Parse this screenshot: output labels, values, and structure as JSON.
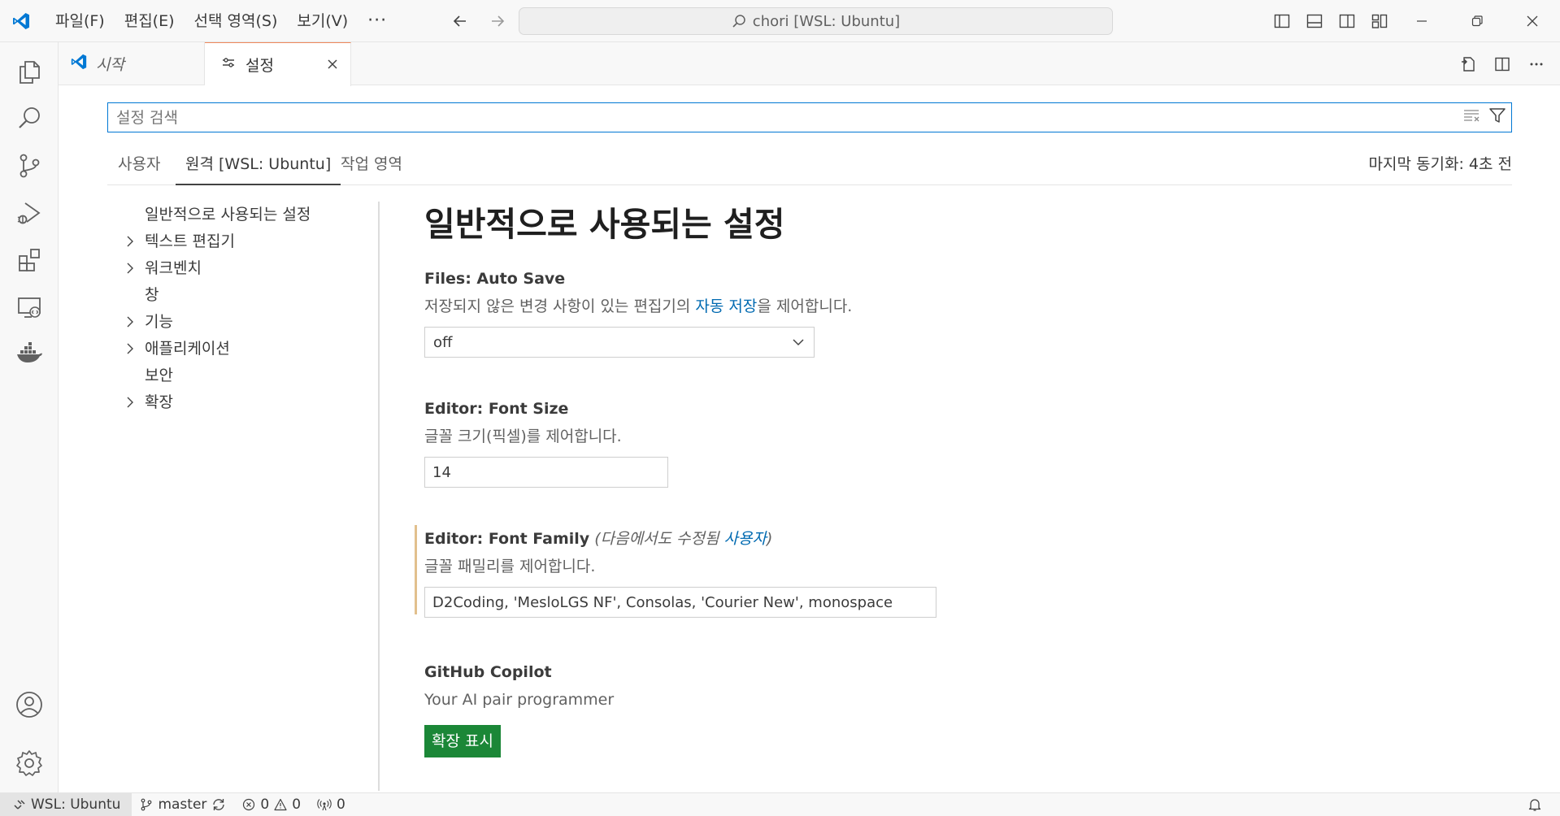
{
  "titlebar": {
    "menu": [
      "파일(F)",
      "편집(E)",
      "선택 영역(S)",
      "보기(V)"
    ],
    "more": "···",
    "command_center": "chori [WSL: Ubuntu]"
  },
  "activity_bar": {
    "items": [
      "explorer-icon",
      "search-icon",
      "source-control-icon",
      "run-debug-icon",
      "extensions-icon",
      "remote-explorer-icon",
      "docker-icon"
    ],
    "bottom_items": [
      "accounts-icon",
      "manage-gear-icon"
    ]
  },
  "tabs": [
    {
      "label": "시작",
      "icon": "vscode-logo-icon"
    },
    {
      "label": "설정",
      "icon": "settings-sliders-icon",
      "active": true
    }
  ],
  "settings": {
    "search_placeholder": "설정 검색",
    "scope_tabs": [
      "사용자",
      "원격 [WSL: Ubuntu]",
      "작업 영역"
    ],
    "active_scope": "원격 [WSL: Ubuntu]",
    "sync_status": "마지막 동기화: 4초 전",
    "toc": [
      {
        "label": "일반적으로 사용되는 설정",
        "expandable": false
      },
      {
        "label": "텍스트 편집기",
        "expandable": true
      },
      {
        "label": "워크벤치",
        "expandable": true
      },
      {
        "label": "창",
        "expandable": false
      },
      {
        "label": "기능",
        "expandable": true
      },
      {
        "label": "애플리케이션",
        "expandable": true
      },
      {
        "label": "보안",
        "expandable": false
      },
      {
        "label": "확장",
        "expandable": true
      }
    ],
    "section_title": "일반적으로 사용되는 설정",
    "auto_save": {
      "category": "Files: ",
      "name": "Auto Save",
      "desc_before": "저장되지 않은 변경 사항이 있는 편집기의 ",
      "desc_link": "자동 저장",
      "desc_after": "을 제어합니다.",
      "value": "off"
    },
    "font_size": {
      "category": "Editor: ",
      "name": "Font Size",
      "desc": "글꼴 크기(픽셀)를 제어합니다.",
      "value": "14"
    },
    "font_family": {
      "category": "Editor: ",
      "name": "Font Family",
      "override_prefix": "(다음에서도 수정됨 ",
      "override_link": "사용자",
      "override_suffix": ")",
      "desc": "글꼴 패밀리를 제어합니다.",
      "value": "D2Coding, 'MesloLGS NF', Consolas, 'Courier New', monospace"
    },
    "copilot": {
      "name": "GitHub Copilot",
      "desc": "Your AI pair programmer",
      "button": "확장 표시"
    }
  },
  "statusbar": {
    "remote": "WSL: Ubuntu",
    "branch": "master",
    "errors": "0",
    "warnings": "0",
    "ports": "0"
  },
  "colors": {
    "accent": "#0078d4",
    "link": "#006ab1",
    "install_button": "#1b8737",
    "modified_indicator": "#e2c08d",
    "active_tab_border": "#f08a5d"
  }
}
